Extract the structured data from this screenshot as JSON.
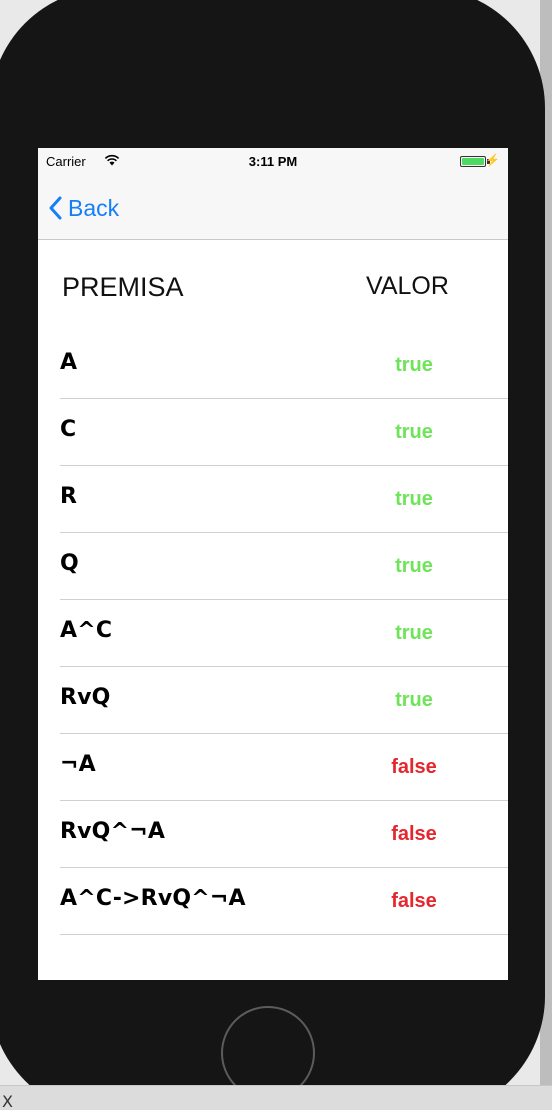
{
  "status": {
    "carrier": "Carrier",
    "time": "3:11 PM",
    "wifi_icon": "wifi-icon",
    "battery_icon": "battery-icon",
    "charge_icon": "⚡"
  },
  "nav": {
    "back_label": "Back",
    "back_icon": "chevron-left-icon",
    "accent_color": "#147efb"
  },
  "table": {
    "header_premise": "PREMISA",
    "header_value": "VALOR",
    "rows": [
      {
        "premise": "A",
        "value": "true"
      },
      {
        "premise": "C",
        "value": "true"
      },
      {
        "premise": "R",
        "value": "true"
      },
      {
        "premise": "Q",
        "value": "true"
      },
      {
        "premise": "A^C",
        "value": "true"
      },
      {
        "premise": "RvQ",
        "value": "true"
      },
      {
        "premise": "¬A",
        "value": "false"
      },
      {
        "premise": "RvQ^¬A",
        "value": "false"
      },
      {
        "premise": "A^C->RvQ^¬A",
        "value": "false"
      }
    ],
    "true_color": "#6fe35a",
    "false_color": "#e6262e"
  },
  "footer_text": "X"
}
